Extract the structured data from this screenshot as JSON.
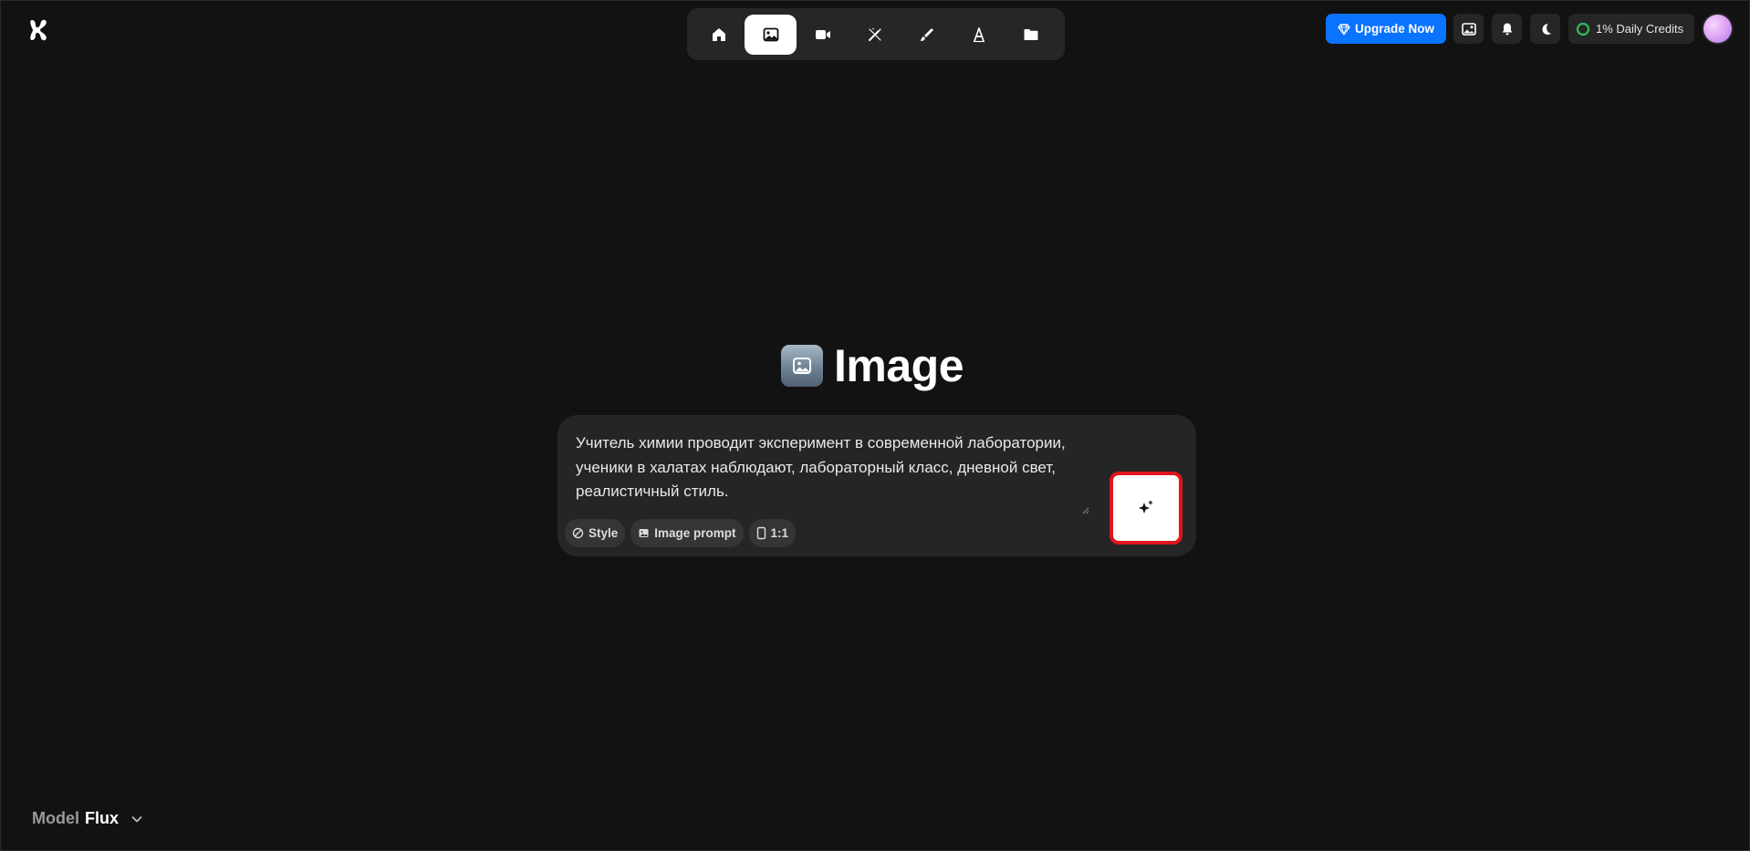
{
  "nav": {
    "items": [
      {
        "id": "home",
        "icon": "home-icon",
        "active": false
      },
      {
        "id": "image",
        "icon": "image-icon",
        "active": true
      },
      {
        "id": "video",
        "icon": "video-icon",
        "active": false
      },
      {
        "id": "magic",
        "icon": "magic-wand-icon",
        "active": false
      },
      {
        "id": "edit",
        "icon": "brush-icon",
        "active": false
      },
      {
        "id": "font",
        "icon": "font-icon",
        "active": false
      },
      {
        "id": "folder",
        "icon": "folder-icon",
        "active": false
      }
    ]
  },
  "header": {
    "upgrade_label": "Upgrade Now",
    "credits_label": "1% Daily Credits",
    "accent_color": "#0a73ff"
  },
  "main": {
    "title": "Image",
    "prompt_text": "Учитель химии проводит эксперимент в современной лаборатории, ученики в халатах наблюдают, лабораторный класс, дневной свет, реалистичный стиль.",
    "chips": {
      "style": "Style",
      "image_prompt": "Image prompt",
      "ratio": "1:1"
    }
  },
  "footer": {
    "model_label": "Model",
    "model_value": "Flux"
  }
}
